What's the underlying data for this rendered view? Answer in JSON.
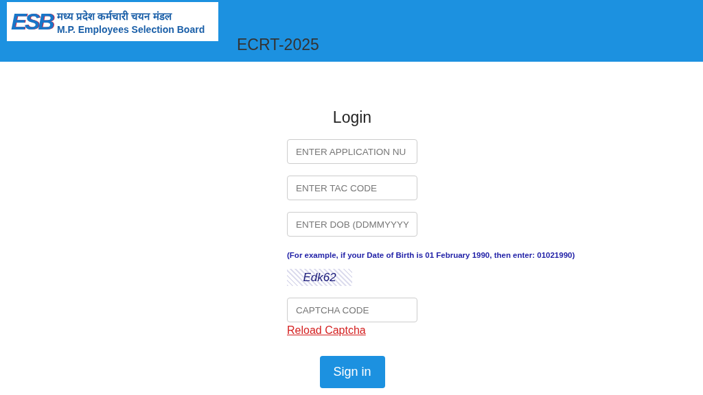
{
  "header": {
    "logo": {
      "mark": "ESB",
      "hindi_name": "मध्य प्रदेश कर्मचारी चयन मंडल",
      "english_name": "M.P. Employees Selection Board"
    },
    "title": "ECRT-2025"
  },
  "login": {
    "heading": "Login",
    "fields": [
      {
        "placeholder": "ENTER APPLICATION NU"
      },
      {
        "placeholder": "ENTER TAC CODE"
      },
      {
        "placeholder": "ENTER DOB (DDMMYYYY"
      }
    ],
    "dob_hint": "(For example, if your Date of Birth is 01 February 1990, then enter: 01021990)",
    "captcha": "Edk62",
    "captcha_field": {
      "placeholder": "CAPTCHA CODE"
    },
    "reload_link": "Reload Captcha",
    "submit": "Sign in"
  }
}
